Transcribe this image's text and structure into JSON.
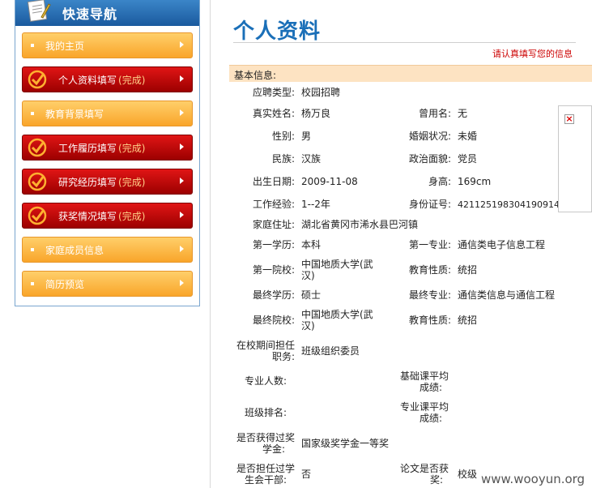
{
  "sidebar": {
    "title": "快速导航",
    "items": [
      {
        "label": "我的主页",
        "style": "orange"
      },
      {
        "label": "个人资料填写",
        "status": "(完成)",
        "style": "red"
      },
      {
        "label": "教育背景填写",
        "style": "orange"
      },
      {
        "label": "工作履历填写",
        "status": "(完成)",
        "style": "red"
      },
      {
        "label": "研究经历填写",
        "status": "(完成)",
        "style": "red"
      },
      {
        "label": "获奖情况填写",
        "status": "(完成)",
        "style": "red"
      },
      {
        "label": "家庭成员信息",
        "style": "orange"
      },
      {
        "label": "简历预览",
        "style": "orange"
      }
    ]
  },
  "main": {
    "title": "个人资料",
    "hint": "请认真填写您的信息",
    "section": "基本信息:",
    "fields": {
      "type_l": "应聘类型:",
      "type_v": "校园招聘",
      "name_l": "真实姓名:",
      "name_v": "杨万良",
      "former_l": "曾用名:",
      "former_v": "无",
      "gender_l": "性别:",
      "gender_v": "男",
      "marital_l": "婚姻状况:",
      "marital_v": "未婚",
      "ethnic_l": "民族:",
      "ethnic_v": "汉族",
      "political_l": "政治面貌:",
      "political_v": "党员",
      "birth_l": "出生日期:",
      "birth_v": "2009-11-08",
      "height_l": "身高:",
      "height_v": "169cm",
      "exp_l": "工作经验:",
      "exp_v": "1--2年",
      "id_l": "身份证号:",
      "id_v": "421125198304190914",
      "addr_l": "家庭住址:",
      "addr_v": "湖北省黄冈市浠水县巴河镇",
      "edu1_l": "第一学历:",
      "edu1_v": "本科",
      "major1_l": "第一专业:",
      "major1_v": "通信类电子信息工程",
      "school1_l": "第一院校:",
      "school1_v1": "中国地质大学(武",
      "school1_v2": "汉)",
      "nature1_l": "教育性质:",
      "nature1_v": "统招",
      "edu2_l": "最终学历:",
      "edu2_v": "硕士",
      "major2_l": "最终专业:",
      "major2_v": "通信类信息与通信工程",
      "school2_l": "最终院校:",
      "school2_v1": "中国地质大学(武",
      "school2_v2": "汉)",
      "nature2_l": "教育性质:",
      "nature2_v": "统招",
      "post_l1": "在校期间担任",
      "post_l2": "职务:",
      "post_v": "班级组织委员",
      "count_l": "专业人数:",
      "basic_l1": "基础课平均",
      "basic_l2": "成绩:",
      "rank_l": "班级排名:",
      "prof_l1": "专业课平均",
      "prof_l2": "成绩:",
      "award_l1": "是否获得过奖",
      "award_l2": "学金:",
      "award_v": "国家级奖学金一等奖",
      "cadre_l1": "是否担任过学",
      "cadre_l2": "生会干部:",
      "cadre_v": "否",
      "paper_l1": "论文是否获",
      "paper_l2": "奖:",
      "paper_v": "校级"
    }
  },
  "watermark": "www.wooyun.org"
}
